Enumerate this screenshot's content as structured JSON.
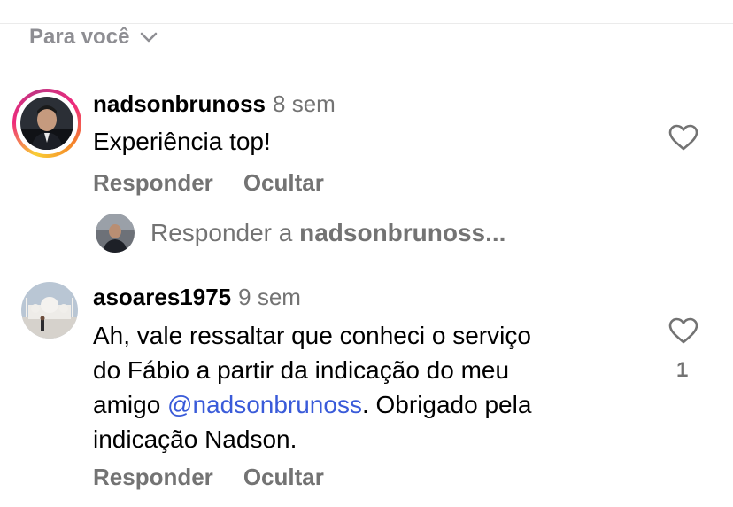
{
  "sort": {
    "label": "Para você",
    "chevron_icon": "chevron-down-icon"
  },
  "comments": [
    {
      "username": "nadsonbrunoss",
      "time": "8 sem",
      "text": "Experiência top!",
      "reply_label": "Responder",
      "hide_label": "Ocultar",
      "like_icon": "heart-outline-icon",
      "story_ring": true
    },
    {
      "username": "asoares1975",
      "time": "9 sem",
      "text_lines": [
        "Ah, vale ressaltar que conheci o serviço",
        "do Fábio a partir da indicação do meu",
        "indicação Nadson."
      ],
      "line3_prefix": "amigo ",
      "mention": "@nadsonbrunoss",
      "line3_suffix": ". Obrigado pela",
      "reply_label": "Responder",
      "hide_label": "Ocultar",
      "like_icon": "heart-outline-icon",
      "like_count": "1"
    }
  ],
  "reply_prompt": {
    "prefix": "Responder a ",
    "target": "nadsonbrunoss..."
  },
  "colors": {
    "secondary_text": "#737373",
    "mention": "#3a5bd9",
    "story_ring": [
      "#f9ce34",
      "#ee2a7b",
      "#c13584"
    ]
  }
}
